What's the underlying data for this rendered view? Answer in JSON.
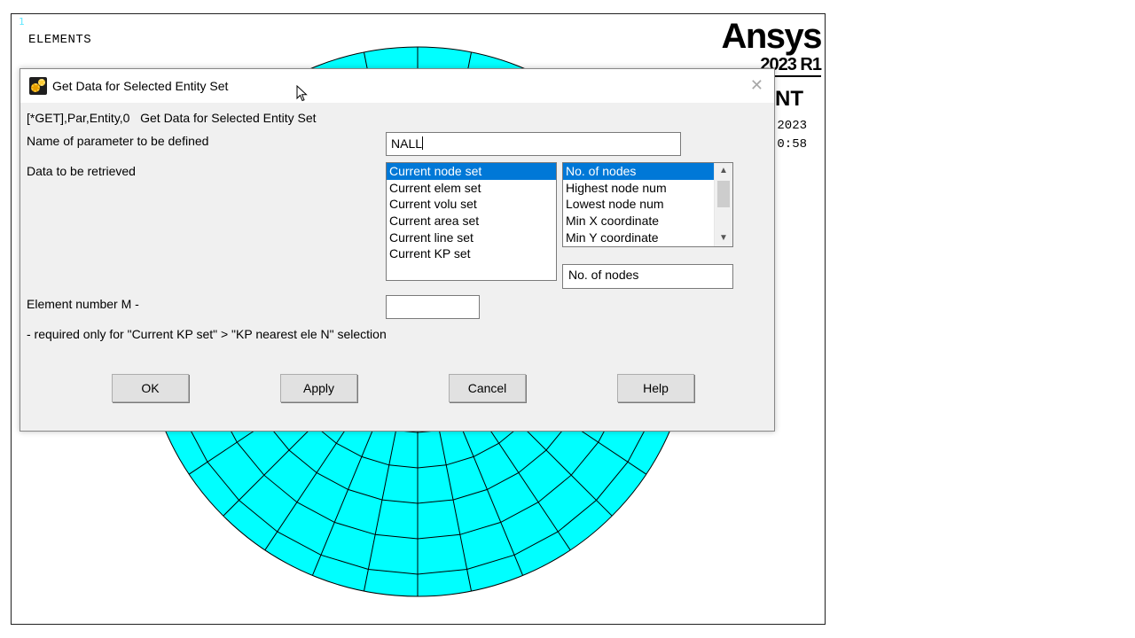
{
  "graphics": {
    "window_number": "1",
    "label": "ELEMENTS",
    "logo_word": "Ansys",
    "version": "2023 R1",
    "edition_partial": "NT",
    "date_partial": "2023",
    "time_partial": "0:58",
    "mesh_color": "#00ffff"
  },
  "dialog": {
    "title": "Get Data for Selected Entity Set",
    "command_line": "[*GET],Par,Entity,0   Get Data for Selected Entity Set",
    "param_label": "Name of parameter to be defined",
    "param_value": "NALL",
    "data_label": "Data to be retrieved",
    "entity_list": [
      "Current node set",
      "Current elem set",
      "Current volu set",
      "Current area set",
      "Current line set",
      "Current KP set"
    ],
    "entity_selected_index": 0,
    "item_list": [
      "No. of nodes",
      "Highest node num",
      "Lowest node num",
      "Min X coordinate",
      "Min Y coordinate"
    ],
    "item_selected_index": 0,
    "item_display": "No. of nodes",
    "element_label": "Element number M -",
    "element_value": "",
    "note": "- required only for \"Current KP set\" > \"KP nearest ele N\" selection",
    "buttons": {
      "ok": "OK",
      "apply": "Apply",
      "cancel": "Cancel",
      "help": "Help"
    },
    "close_icon": "close-icon",
    "title_icon": "gears-icon"
  },
  "colors": {
    "selection": "#0078d7",
    "dialog_bg": "#f0f0f0"
  }
}
